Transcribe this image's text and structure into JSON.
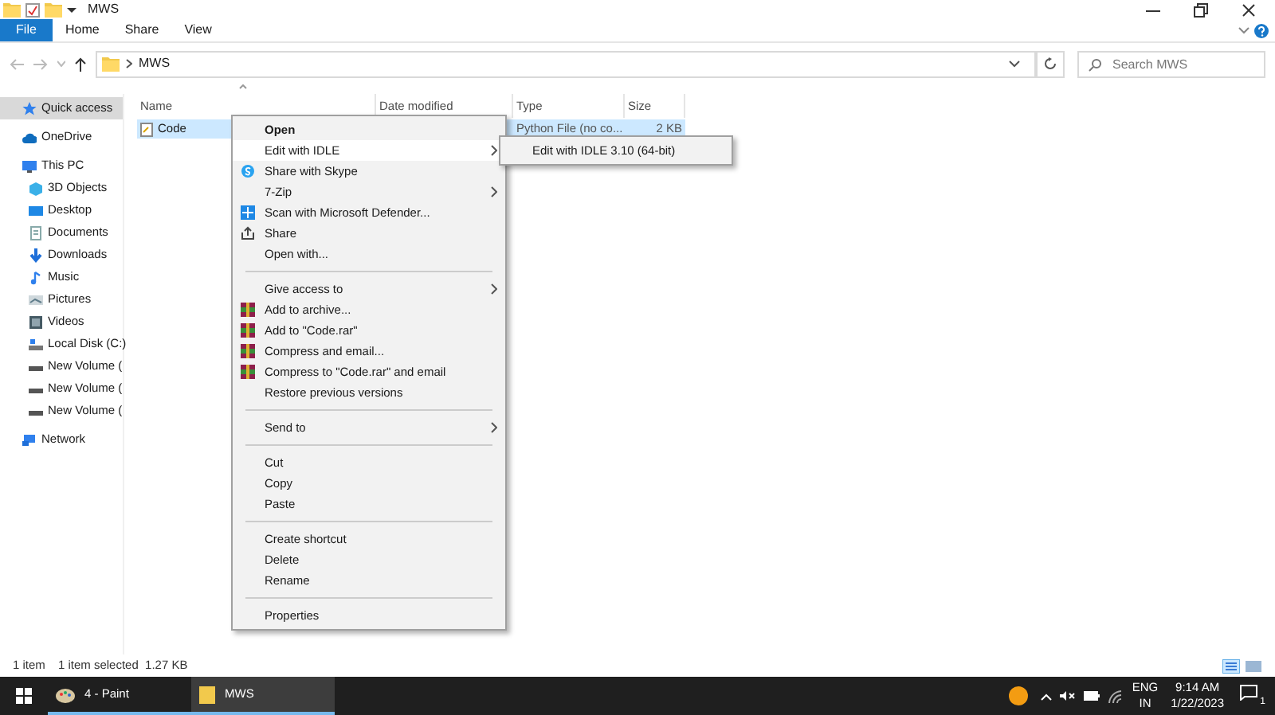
{
  "window": {
    "title": "MWS"
  },
  "ribbon_tabs": [
    {
      "label": "File",
      "selected": true
    },
    {
      "label": "Home",
      "selected": false
    },
    {
      "label": "Share",
      "selected": false
    },
    {
      "label": "View",
      "selected": false
    }
  ],
  "address": {
    "path": "MWS"
  },
  "search": {
    "placeholder": "Search MWS"
  },
  "sidebar": {
    "items": [
      {
        "label": "Quick access",
        "kind": "star",
        "selected": true
      },
      {
        "label": "OneDrive",
        "kind": "cloud",
        "selected": false
      },
      {
        "label": "This PC",
        "kind": "pc",
        "selected": false,
        "children": [
          {
            "label": "3D Objects",
            "kind": "cube",
            "selected": false
          },
          {
            "label": "Desktop",
            "kind": "desktop",
            "selected": false
          },
          {
            "label": "Documents",
            "kind": "doc",
            "selected": false
          },
          {
            "label": "Downloads",
            "kind": "download",
            "selected": false
          },
          {
            "label": "Music",
            "kind": "music",
            "selected": false
          },
          {
            "label": "Pictures",
            "kind": "picture",
            "selected": false
          },
          {
            "label": "Videos",
            "kind": "video",
            "selected": false
          },
          {
            "label": "Local Disk (C:)",
            "kind": "disk",
            "selected": false
          },
          {
            "label": "New Volume (",
            "kind": "drive",
            "selected": false
          },
          {
            "label": "New Volume (",
            "kind": "drive",
            "selected": false
          },
          {
            "label": "New Volume (",
            "kind": "drive",
            "selected": false
          }
        ]
      },
      {
        "label": "Network",
        "kind": "network",
        "selected": false
      }
    ]
  },
  "table": {
    "columns": [
      "Name",
      "Date modified",
      "Type",
      "Size"
    ],
    "rows": [
      {
        "name": "Code",
        "date_modified": "",
        "type": "Python File (no co...",
        "size": "2 KB",
        "selected": true
      }
    ]
  },
  "context_menu": {
    "items": [
      {
        "kind": "plain",
        "label": "Open",
        "bold": true,
        "submenu": false,
        "selected": false
      },
      {
        "kind": "plain",
        "label": "Edit with IDLE",
        "bold": false,
        "submenu": true,
        "selected": true
      },
      {
        "kind": "skype",
        "label": "Share with Skype",
        "bold": false,
        "submenu": false,
        "selected": false
      },
      {
        "kind": "plain",
        "label": "7-Zip",
        "bold": false,
        "submenu": true,
        "selected": false
      },
      {
        "kind": "defender",
        "label": "Scan with Microsoft Defender...",
        "bold": false,
        "submenu": false,
        "selected": false
      },
      {
        "kind": "share",
        "label": "Share",
        "bold": false,
        "submenu": false,
        "selected": false
      },
      {
        "kind": "plain",
        "label": "Open with...",
        "bold": false,
        "submenu": false,
        "selected": false
      },
      {
        "kind": "separator"
      },
      {
        "kind": "plain",
        "label": "Give access to",
        "bold": false,
        "submenu": true,
        "selected": false
      },
      {
        "kind": "archive",
        "label": "Add to archive...",
        "bold": false,
        "submenu": false,
        "selected": false
      },
      {
        "kind": "archive",
        "label": "Add to \"Code.rar\"",
        "bold": false,
        "submenu": false,
        "selected": false
      },
      {
        "kind": "archive",
        "label": "Compress and email...",
        "bold": false,
        "submenu": false,
        "selected": false
      },
      {
        "kind": "archive",
        "label": "Compress to \"Code.rar\" and email",
        "bold": false,
        "submenu": false,
        "selected": false
      },
      {
        "kind": "plain",
        "label": "Restore previous versions",
        "bold": false,
        "submenu": false,
        "selected": false
      },
      {
        "kind": "separator"
      },
      {
        "kind": "plain",
        "label": "Send to",
        "bold": false,
        "submenu": true,
        "selected": false
      },
      {
        "kind": "separator"
      },
      {
        "kind": "plain",
        "label": "Cut",
        "bold": false,
        "submenu": false,
        "selected": false
      },
      {
        "kind": "plain",
        "label": "Copy",
        "bold": false,
        "submenu": false,
        "selected": false
      },
      {
        "kind": "plain",
        "label": "Paste",
        "bold": false,
        "submenu": false,
        "selected": false
      },
      {
        "kind": "separator"
      },
      {
        "kind": "plain",
        "label": "Create shortcut",
        "bold": false,
        "submenu": false,
        "selected": false
      },
      {
        "kind": "plain",
        "label": "Delete",
        "bold": false,
        "submenu": false,
        "selected": false
      },
      {
        "kind": "plain",
        "label": "Rename",
        "bold": false,
        "submenu": false,
        "selected": false
      },
      {
        "kind": "separator"
      },
      {
        "kind": "plain",
        "label": "Properties",
        "bold": false,
        "submenu": false,
        "selected": false
      }
    ]
  },
  "submenu": {
    "items": [
      "Edit with IDLE 3.10 (64-bit)"
    ]
  },
  "status_bar": {
    "count": "1 item",
    "selection": "1 item selected  1.27 KB"
  },
  "taskbar": {
    "apps": [
      {
        "label": "4 - Paint",
        "kind": "paint",
        "selected": false
      },
      {
        "label": "MWS",
        "kind": "folder",
        "selected": true
      }
    ],
    "language": "ENG",
    "region": "IN",
    "time": "9:14 AM",
    "date": "1/22/2023",
    "notification_count": "1"
  }
}
